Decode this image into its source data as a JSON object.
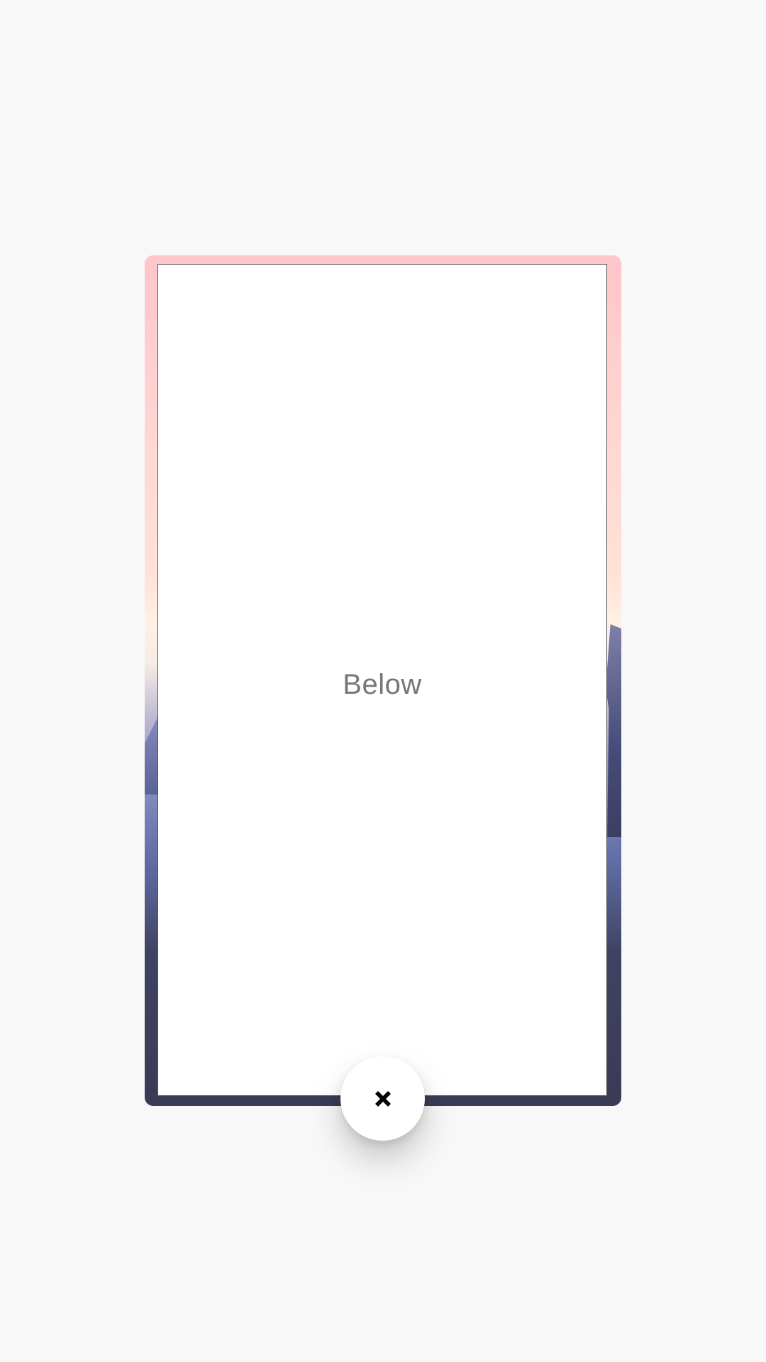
{
  "preview": {
    "label": "Below"
  },
  "close_button": {
    "icon": "close-icon"
  },
  "colors": {
    "background": "#f8f8f8",
    "panel": "#ffffff",
    "label_text": "#767676",
    "gradient_top": "#ffc5c9",
    "gradient_bottom": "#3a3b56"
  }
}
